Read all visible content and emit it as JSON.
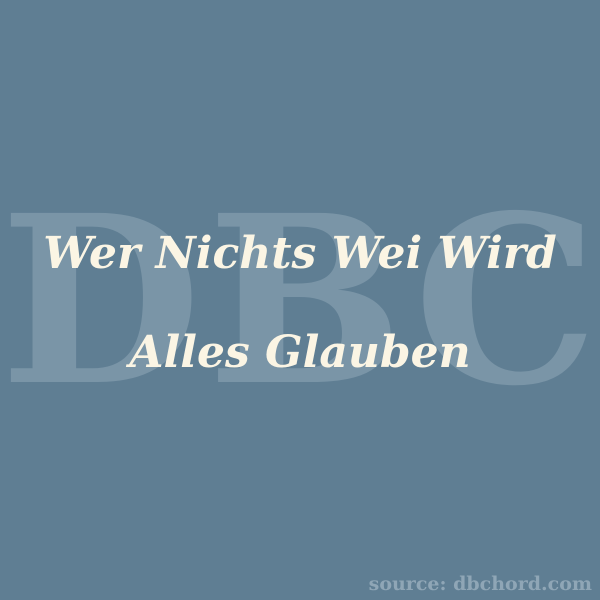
{
  "colors": {
    "background": "#5f7e93",
    "watermark": "#7a95a7",
    "title": "#fbf5e4",
    "source": "#8fa6b6"
  },
  "watermark": {
    "text": "DBC"
  },
  "title": {
    "line1": "Wer Nichts Wei Wird",
    "line2": "Alles Glauben"
  },
  "source": {
    "text": "source: dbchord.com"
  }
}
